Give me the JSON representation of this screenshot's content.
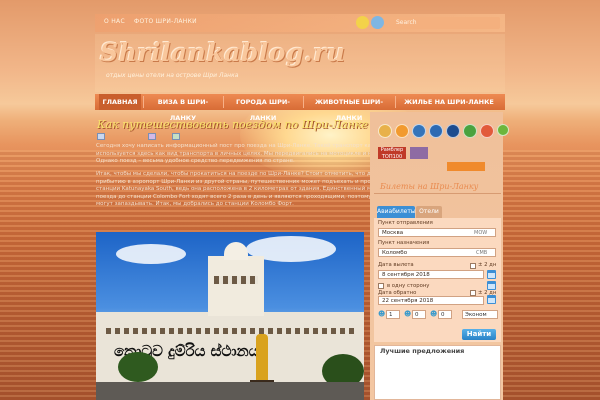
{
  "top_nav": {
    "links": [
      "О НАС",
      "ФОТО ШРИ-ЛАНКИ"
    ],
    "search_placeholder": "Search"
  },
  "site": {
    "logo": "Shrilankablog.ru",
    "tagline": "отдых цены отели на острове Шри Ланка"
  },
  "main_nav": {
    "items": [
      "ГЛАВНАЯ",
      "ВИЗА В ШРИ-ЛАНКУ",
      "ГОРОДА ШРИ-ЛАНКИ",
      "ЖИВОТНЫЕ ШРИ-ЛАНКИ",
      "ЖИЛЬЕ НА ШРИ-ЛАНКЕ"
    ],
    "active_index": 0
  },
  "post": {
    "title": "Как путешествовать поездом по Шри-Ланке",
    "meta": [
      "",
      "",
      ""
    ],
    "paragraph1": "Сегодня хочу написать информационный пост про поезда на Шри-Ланке. Такой транспорт как поезд используется здесь как вид транспорта в личных целях. Мы передвигались на мотоцикле и на автобусах. Однако поезд – весьма удобное средство передвижения по стране.",
    "paragraph2": "Итак, чтобы мы сделали, чтобы прокатиться на поезде по Шри-Ланке? Стоит отметить, что даже по прибытию в аэропорт Шри-Ланки из другой страны, путешественник может подъехать и прогуляться до станции Katunayaka South, ведь она расположена в 2 километрах от здания. Единственный минус – поезда до станции Colombo Fort ходят всего 2 раза в день и являются проходящими, поэтому многие могут запаздывать. Итак, мы добрались до станции Коломбо Форт.",
    "photo_sign": "කොටුව දුම්රිය ස්ථානය"
  },
  "sidebar": {
    "rambler_label": "Рамблер ТОП100",
    "widget_title": "Билеты на Шри-Ланку",
    "tabs": [
      "Авиабилеты",
      "Отели"
    ],
    "from_label": "Пункт отправления",
    "from_value": "Москва",
    "from_code": "MOW",
    "to_label": "Пункт назначения",
    "to_value": "Коломбо",
    "to_code": "CMB",
    "depart_label": "Дата вылета",
    "depart_flex": "± 2 дн",
    "depart_value": "8 сентября 2018",
    "oneway_label": "в одну сторону",
    "return_label": "Дата обратно",
    "return_flex": "± 2 дн",
    "return_value": "22 сентября 2018",
    "passengers": [
      "1",
      "0",
      "0"
    ],
    "class_value": "Эконом",
    "find_button": "Найти",
    "best_title": "Лучшие предложения"
  },
  "colors": {
    "nav_active": "#c95f2d",
    "nav": "#e27a43",
    "tab_active": "#3c8fd5",
    "tab_inactive": "#d9a57d",
    "find": "#2a83c7"
  },
  "icons": [
    "email-icon",
    "rss-icon",
    "delicious-icon",
    "digg-icon",
    "myspace-icon",
    "stumbleupon-icon",
    "technorati-icon",
    "favorite-icon",
    "add-icon"
  ]
}
